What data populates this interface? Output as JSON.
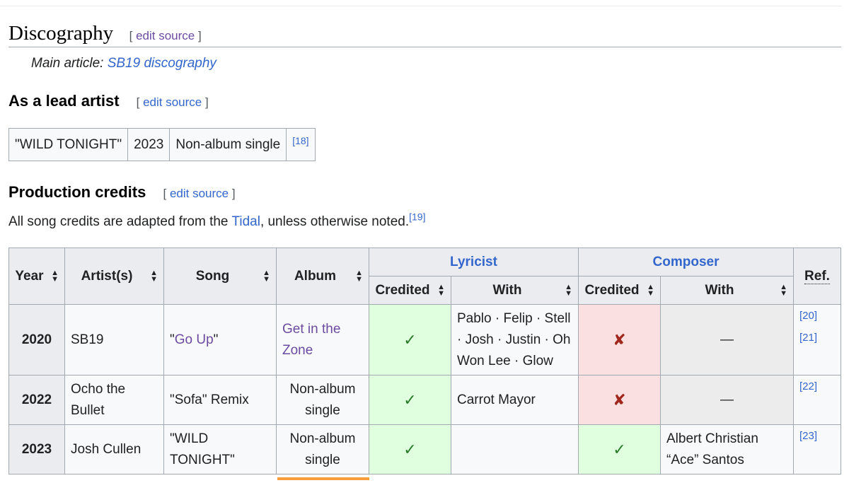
{
  "section": {
    "title": "Discography",
    "edit_label": "edit source",
    "hatnote_prefix": "Main article: ",
    "hatnote_link": "SB19 discography"
  },
  "lead": {
    "heading": "As a lead artist",
    "edit_label": "edit source",
    "row": {
      "song": "\"WILD TONIGHT\"",
      "year": "2023",
      "album": "Non-album single",
      "ref": "[18]"
    }
  },
  "production": {
    "heading": "Production credits",
    "edit_label": "edit source",
    "intro_before": "All song credits are adapted from the ",
    "intro_link": "Tidal",
    "intro_after": ", unless otherwise noted.",
    "intro_ref": "[19]"
  },
  "table": {
    "headers": {
      "year": "Year",
      "artists": "Artist(s)",
      "song": "Song",
      "album": "Album",
      "lyricist": "Lyricist",
      "composer": "Composer",
      "credited": "Credited",
      "with": "With",
      "ref": "Ref."
    },
    "rows": [
      {
        "year": "2020",
        "artist": "SB19",
        "song_open": "\"",
        "song_link": "Go Up",
        "song_close": "\"",
        "album": "Get in the Zone",
        "lyricist_credited": "✓",
        "lyricist_with": "Pablo · Felip · Stell · Josh · Justin · Oh Won Lee · Glow",
        "composer_credited": "✘",
        "composer_with": "—",
        "ref": "[20][21]"
      },
      {
        "year": "2022",
        "artist": "Ocho the Bullet",
        "song": "\"Sofa\" Remix",
        "album": "Non-album single",
        "lyricist_credited": "✓",
        "lyricist_with": "Carrot Mayor",
        "composer_credited": "✘",
        "composer_with": "—",
        "ref": "[22]"
      },
      {
        "year": "2023",
        "artist": "Josh Cullen",
        "song": "\"WILD TONIGHT\"",
        "album": "Non-album single",
        "lyricist_credited": "✓",
        "lyricist_with": "",
        "composer_credited": "✓",
        "composer_with": "Albert Christian “Ace” Santos",
        "ref": "[23]"
      }
    ]
  },
  "icons": {
    "sort": "sort-icon",
    "check": "check-icon",
    "cross": "cross-icon"
  },
  "colors": {
    "link": "#3366cc",
    "visited": "#6b4ba1",
    "yes_bg": "#dfffdf",
    "no_bg": "#fae0e0",
    "header_bg": "#eaecf0"
  }
}
